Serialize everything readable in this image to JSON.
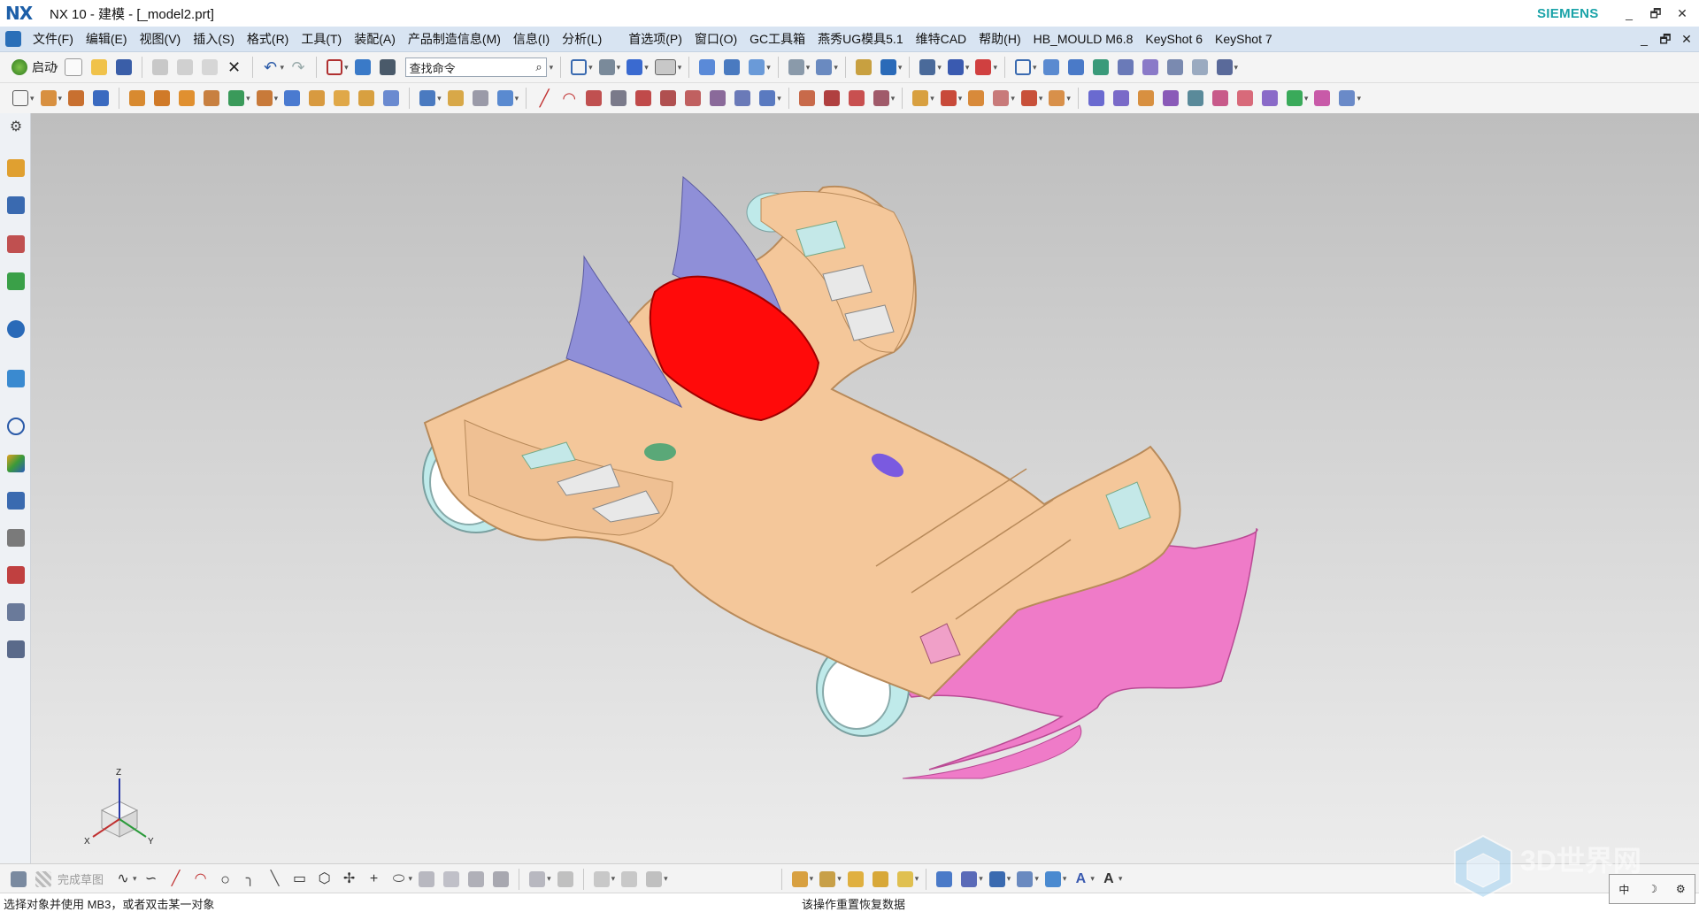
{
  "app": {
    "logo": "NX",
    "window_title": "NX 10 - 建模 - [_model2.prt]",
    "brand": "SIEMENS",
    "window_controls": [
      "_",
      "🗗",
      "✕"
    ],
    "doc_controls": [
      "_",
      "🗗",
      "✕"
    ]
  },
  "menubar": {
    "items": [
      "文件(F)",
      "编辑(E)",
      "视图(V)",
      "插入(S)",
      "格式(R)",
      "工具(T)",
      "装配(A)",
      "产品制造信息(M)",
      "信息(I)",
      "分析(L)"
    ],
    "items_right": [
      "首选项(P)",
      "窗口(O)",
      "GC工具箱",
      "燕秀UG模具5.1",
      "维特CAD",
      "帮助(H)",
      "HB_MOULD M6.8",
      "KeyShot 6",
      "KeyShot 7"
    ]
  },
  "toolbar1": {
    "start_label": "启动",
    "search_placeholder": "查找命令"
  },
  "bottom_toolbar": {
    "finish_sketch_label": "完成草图"
  },
  "statusbar": {
    "left": "选择对象并使用 MB3，或者双击某一对象",
    "middle": "该操作重置恢复数据"
  },
  "ime": {
    "items": [
      "中",
      "☽",
      "⚙"
    ]
  },
  "watermark": {
    "text": "3D世界网"
  },
  "triad": {
    "x": "X",
    "y": "Y",
    "z": "Z"
  },
  "colors": {
    "body_tan": "#f4c79a",
    "canopy_red": "#ff0a0a",
    "fin_purple": "#8f8fd8",
    "chassis_pink": "#ee78c8",
    "wheel_cyan": "#bfeaea",
    "nx_blue": "#1d5fa8",
    "siemens_teal": "#1aa3a8",
    "menubar_bg": "#d8e4f2"
  }
}
